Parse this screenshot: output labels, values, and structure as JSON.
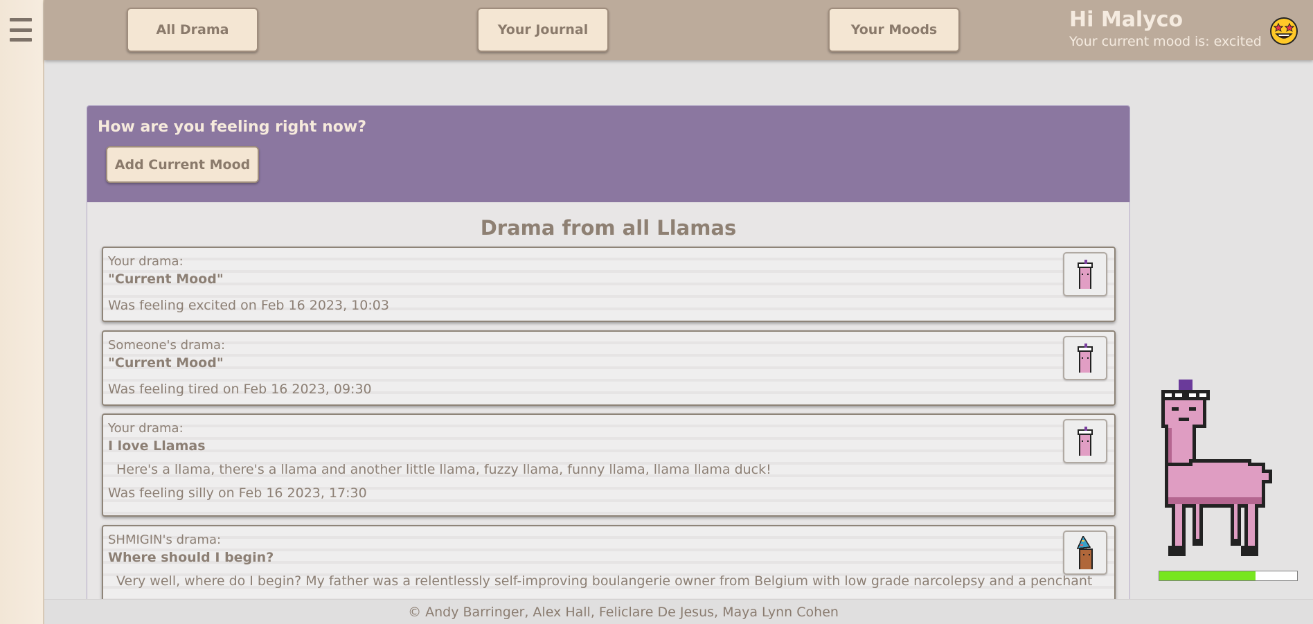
{
  "nav": {
    "all_drama": "All Drama",
    "journal": "Your Journal",
    "moods": "Your Moods"
  },
  "user": {
    "greeting": "Hi Malyco",
    "mood_text": "Your current mood is: excited",
    "mood_icon": "star-struck-emoji-icon"
  },
  "mood_prompt": {
    "question": "How are you feeling right now?",
    "button": "Add Current Mood"
  },
  "feed": {
    "title": "Drama from all Llamas",
    "items": [
      {
        "who": "Your drama:",
        "title": "\"Current Mood\"",
        "body": "",
        "date": "Was feeling excited on Feb 16 2023, 10:03",
        "avatar": "pink-llama-tiara-icon"
      },
      {
        "who": "Someone's drama:",
        "title": "\"Current Mood\"",
        "body": "",
        "date": "Was feeling tired on Feb 16 2023, 09:30",
        "avatar": "pink-llama-tiara-icon"
      },
      {
        "who": "Your drama:",
        "title": "I love Llamas",
        "body": "Here's a llama, there's a llama and another little llama, fuzzy llama, funny llama, llama llama duck!",
        "date": "Was feeling silly on Feb 16 2023, 17:30",
        "avatar": "pink-llama-tiara-icon"
      },
      {
        "who": "SHMIGIN's drama:",
        "title": "Where should I begin?",
        "body": "Very well, where do I begin? My father was a relentlessly self-improving boulangerie owner from Belgium with low grade narcolepsy and a penchant for",
        "date": "",
        "avatar": "brown-llama-party-hat-icon"
      }
    ]
  },
  "pet": {
    "energy": 0.7,
    "bar_color": "#77e61f"
  },
  "footer": {
    "credits": "© Andy Barringer, Alex Hall, Feliclare De Jesus, Maya Lynn Cohen"
  },
  "colors": {
    "topbar": "#bcab9b",
    "mood_header": "#8b77a0",
    "button_bg": "#f4e6d3"
  }
}
